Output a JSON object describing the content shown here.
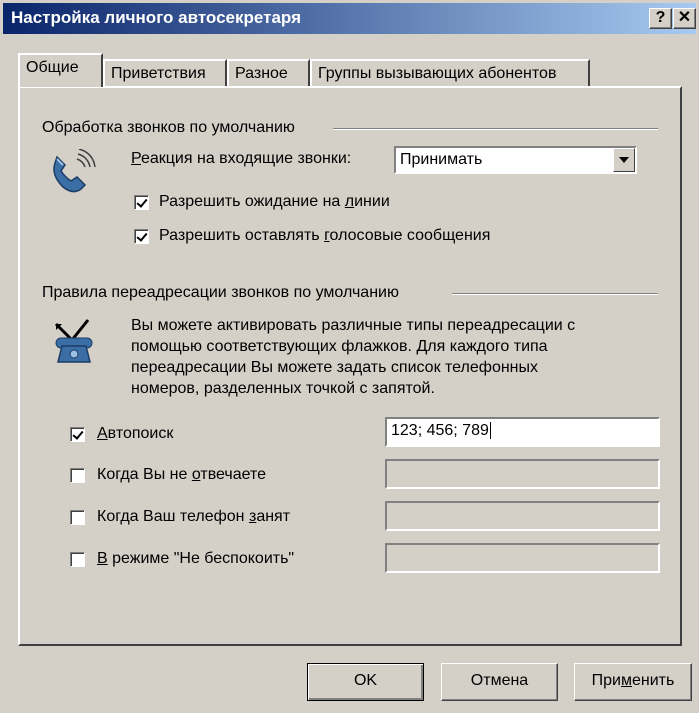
{
  "window": {
    "title": "Настройка личного автосекретаря",
    "help_button": "?",
    "close_button": "✕"
  },
  "tabs": [
    {
      "label": "Общие",
      "active": true
    },
    {
      "label": "Приветствия",
      "active": false
    },
    {
      "label": "Разное",
      "active": false
    },
    {
      "label": "Группы вызывающих абонентов",
      "active": false
    }
  ],
  "default_handling": {
    "section_title": "Обработка звонков по умолчанию",
    "icon": "ringing-phone-icon",
    "reaction_label_accel": "Р",
    "reaction_label_rest": "еакция на входящие звонки:",
    "reaction_value": "Принимать",
    "allow_hold": {
      "pre": "Разрешить ожидание на ",
      "accel": "л",
      "post": "инии",
      "checked": true
    },
    "allow_voicemail": {
      "pre": "Разрешить оставлять ",
      "accel": "г",
      "post": "олосовые сообщения",
      "checked": true
    }
  },
  "forwarding": {
    "section_title": "Правила переадресации звонков по умолчанию",
    "icon": "forwarding-phone-icon",
    "description_lines": [
      "Вы можете активировать различные типы переадресации с",
      "помощью соответствующих флажков. Для каждого типа",
      "переадресации Вы можете задать список телефонных",
      "номеров, разделенных точкой с запятой."
    ],
    "rules": [
      {
        "pre": "",
        "accel": "А",
        "post": "втопоиск",
        "checked": true,
        "value": "123; 456; 789",
        "enabled": true
      },
      {
        "pre": "Когда Вы не ",
        "accel": "о",
        "post": "твечаете",
        "checked": false,
        "value": "",
        "enabled": false
      },
      {
        "pre": "Когда Ваш телефон ",
        "accel": "з",
        "post": "анят",
        "checked": false,
        "value": "",
        "enabled": false
      },
      {
        "pre": "",
        "accel": "В",
        "post": " режиме \"Не беспокоить\"",
        "checked": false,
        "value": "",
        "enabled": false
      }
    ]
  },
  "buttons": {
    "ok": "OK",
    "cancel": "Отмена",
    "apply_pre": "При",
    "apply_accel": "м",
    "apply_post": "енить"
  },
  "colors": {
    "face": "#d4d0c8",
    "title_start": "#0a246a",
    "title_end": "#a6caf0"
  }
}
